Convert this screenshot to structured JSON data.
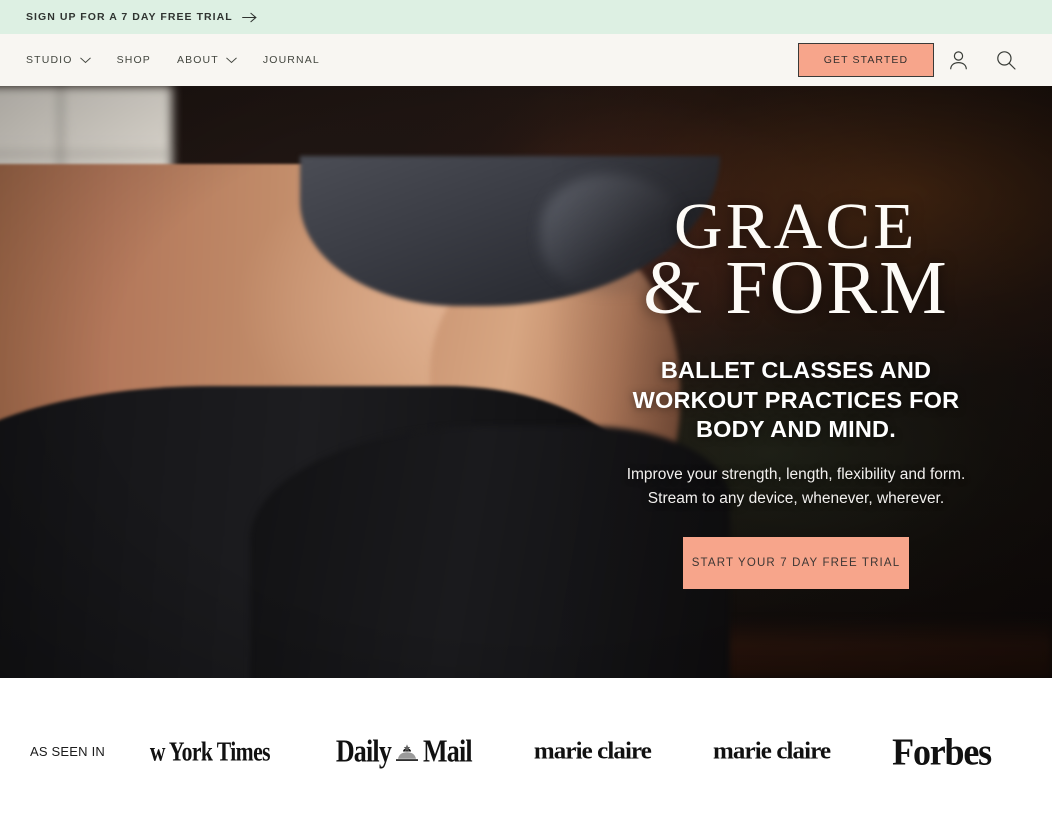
{
  "announcement": {
    "label": "SIGN UP FOR A 7 DAY FREE TRIAL",
    "icon": "arrow-right-icon",
    "background": "#ddf0e3"
  },
  "nav": {
    "background": "#f8f6f2",
    "items": [
      {
        "label": "STUDIO",
        "has_dropdown": true,
        "icon": "chevron-down-icon"
      },
      {
        "label": "SHOP",
        "has_dropdown": false,
        "icon": ""
      },
      {
        "label": "ABOUT",
        "has_dropdown": true,
        "icon": "chevron-down-icon"
      },
      {
        "label": "JOURNAL",
        "has_dropdown": false,
        "icon": ""
      }
    ],
    "cta": {
      "label": "GET STARTED",
      "background": "#f7a58b",
      "border": "#3a3a38"
    },
    "account_icon": "user-account-icon",
    "search_icon": "search-icon"
  },
  "hero": {
    "wordmark_line1": "GRACE",
    "wordmark_line2": "& FORM",
    "tagline": "BALLET CLASSES AND WORKOUT PRACTICES FOR BODY AND MIND.",
    "subcopy": "Improve your strength, length, flexibility and form. Stream to any device, whenever, wherever.",
    "cta_label": "START YOUR 7 DAY FREE TRIAL",
    "cta_background": "#f7a58b"
  },
  "press": {
    "label": "AS SEEN IN",
    "logos": [
      {
        "name": "the-new-york-times",
        "text": "w York Times"
      },
      {
        "name": "daily-mail",
        "text_before": "Daily",
        "text_after": "Mail"
      },
      {
        "name": "marie-claire-1",
        "text": "marie claire"
      },
      {
        "name": "marie-claire-2",
        "text": "marie claire"
      },
      {
        "name": "forbes",
        "text": "Forbes"
      }
    ]
  }
}
